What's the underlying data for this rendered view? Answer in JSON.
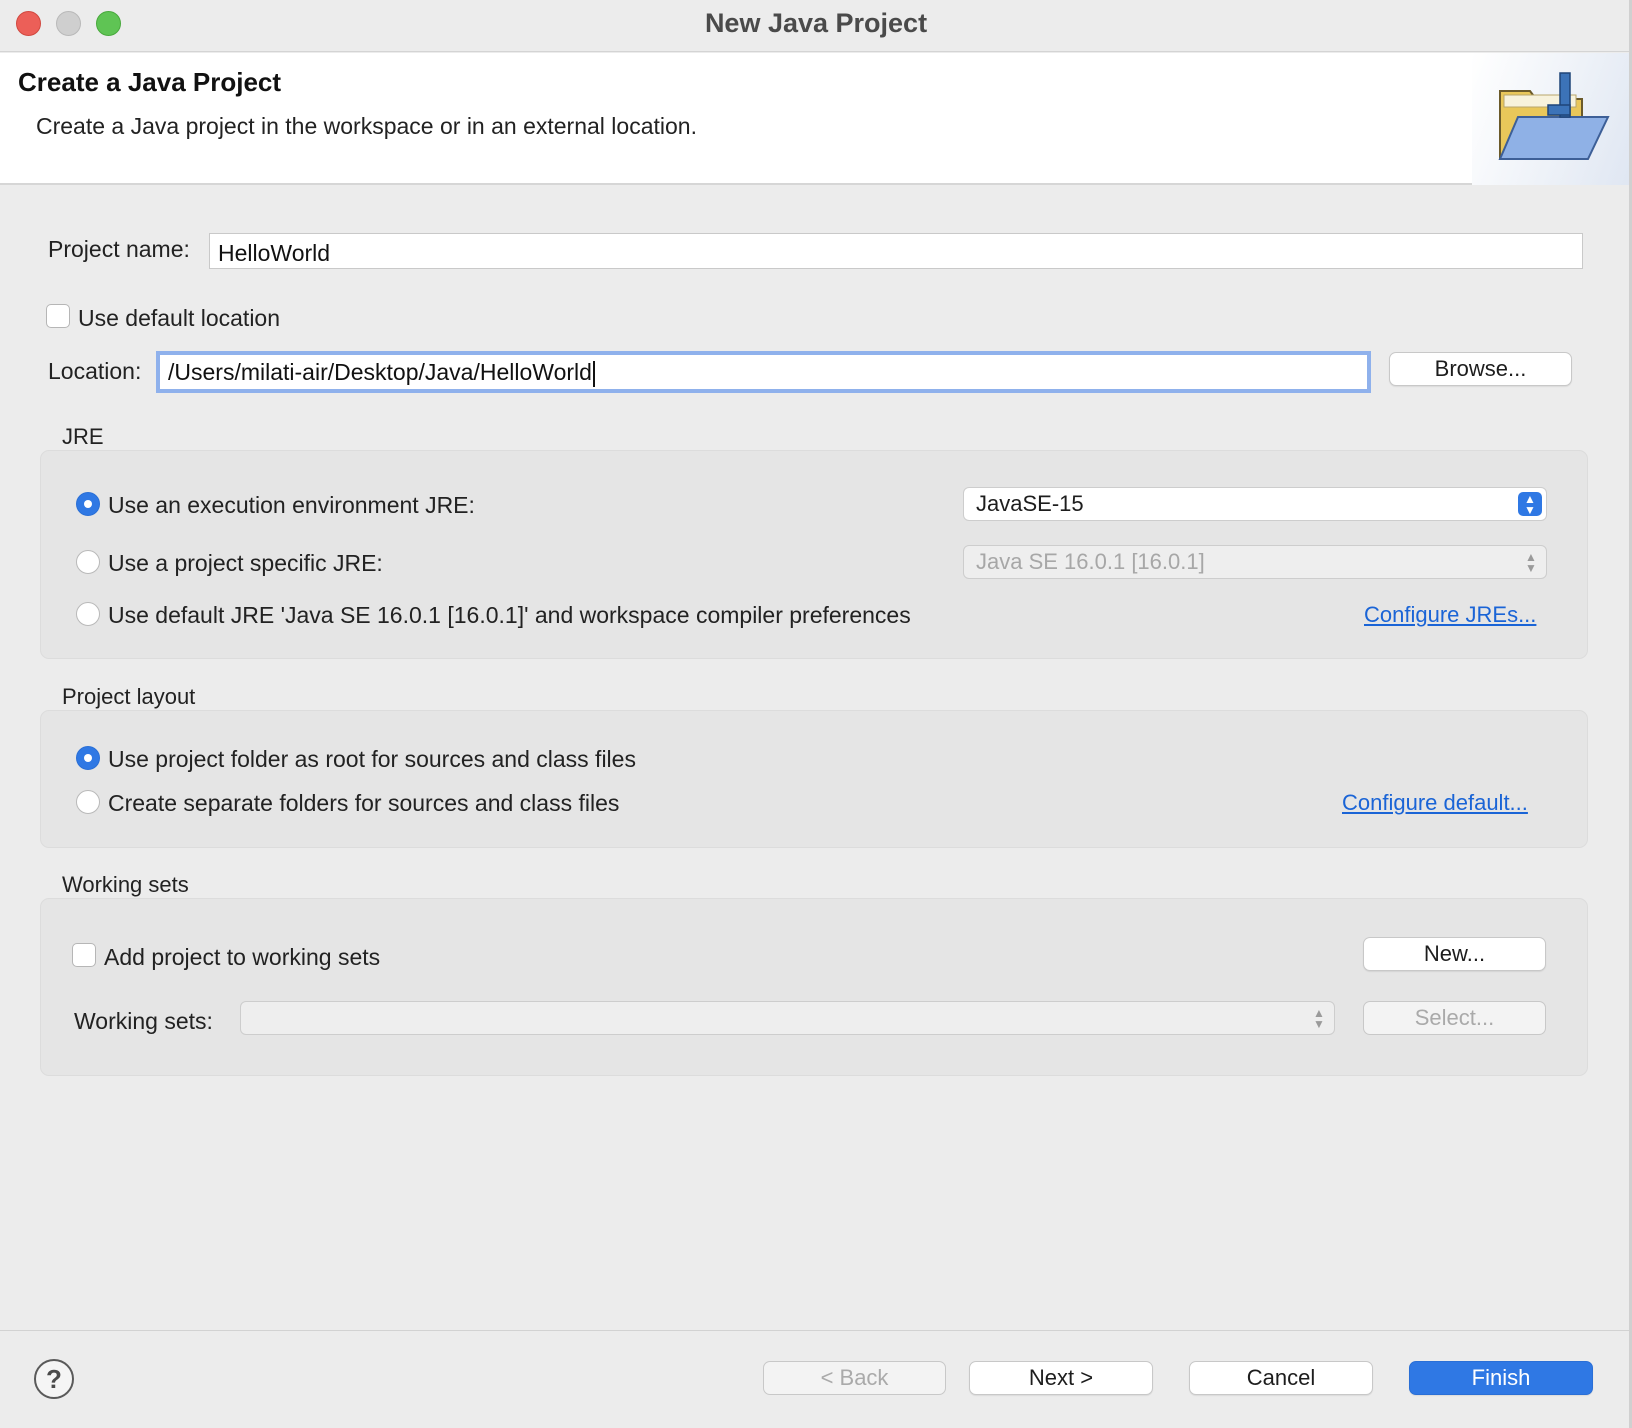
{
  "window": {
    "title": "New Java Project"
  },
  "banner": {
    "title": "Create a Java Project",
    "description": "Create a Java project in the workspace or in an external location.",
    "icon": "java-project-folder-icon"
  },
  "project_name": {
    "label": "Project name:",
    "value": "HelloWorld"
  },
  "default_location": {
    "label": "Use default location",
    "checked": false
  },
  "location": {
    "label": "Location:",
    "value": "/Users/milati-air/Desktop/Java/HelloWorld",
    "browse_label": "Browse..."
  },
  "jre": {
    "title": "JRE",
    "options": [
      {
        "label": "Use an execution environment JRE:",
        "selected": true
      },
      {
        "label": "Use a project specific JRE:",
        "selected": false
      },
      {
        "label": "Use default JRE 'Java SE 16.0.1 [16.0.1]' and workspace compiler preferences",
        "selected": false
      }
    ],
    "execution_env_value": "JavaSE-15",
    "project_specific_value": "Java SE 16.0.1 [16.0.1]",
    "configure_link": "Configure JREs..."
  },
  "layout": {
    "title": "Project layout",
    "options": [
      {
        "label": "Use project folder as root for sources and class files",
        "selected": true
      },
      {
        "label": "Create separate folders for sources and class files",
        "selected": false
      }
    ],
    "configure_link": "Configure default..."
  },
  "working_sets": {
    "title": "Working sets",
    "add_label": "Add project to working sets",
    "add_checked": false,
    "new_label": "New...",
    "sets_label": "Working sets:",
    "sets_value": "",
    "select_label": "Select..."
  },
  "footer": {
    "help_icon": "help-icon",
    "back_label": "< Back",
    "next_label": "Next >",
    "cancel_label": "Cancel",
    "finish_label": "Finish"
  },
  "colors": {
    "accent": "#2f78e4",
    "link": "#1a64d6",
    "focus_ring": "#8fb1ec"
  }
}
